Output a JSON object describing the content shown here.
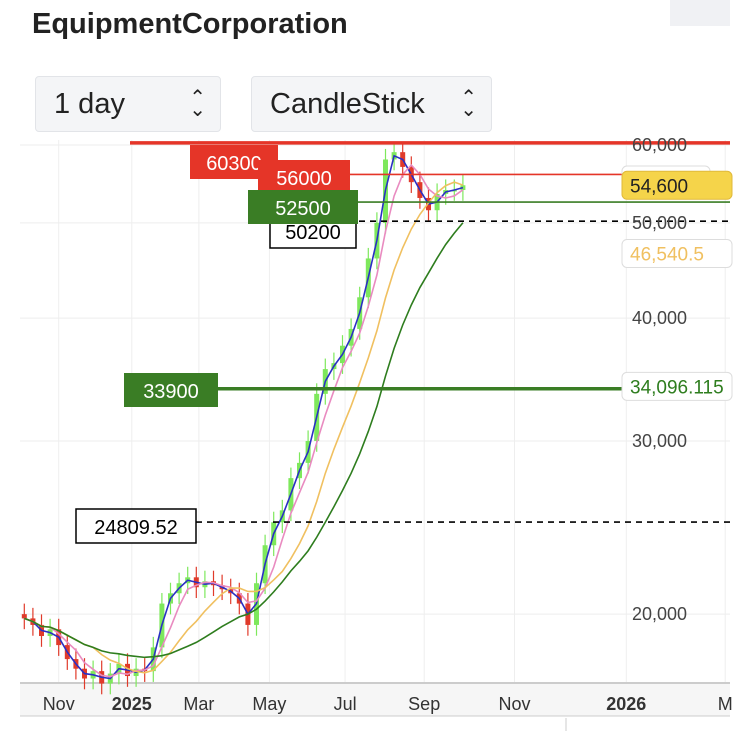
{
  "title": "EquipmentCorporation",
  "controls": {
    "interval": "1 day",
    "chart_type": "CandleStick"
  },
  "chart_data": {
    "type": "candlestick",
    "scale": "log",
    "ylim": [
      16500,
      62000
    ],
    "y_ticks": [
      {
        "v": 60000,
        "label": "60,000"
      },
      {
        "v": 50000,
        "label": "50,000"
      },
      {
        "v": 40000,
        "label": "40,000"
      },
      {
        "v": 30000,
        "label": "30,000"
      },
      {
        "v": 20000,
        "label": "20,000"
      }
    ],
    "x_ticks": [
      {
        "w": 4.5,
        "label": "Nov",
        "bold": false
      },
      {
        "w": 13,
        "label": "2025",
        "bold": true
      },
      {
        "w": 20.8,
        "label": "Mar",
        "bold": false
      },
      {
        "w": 29,
        "label": "May",
        "bold": false
      },
      {
        "w": 37.8,
        "label": "Jul",
        "bold": false
      },
      {
        "w": 47,
        "label": "Sep",
        "bold": false
      },
      {
        "w": 57.5,
        "label": "Nov",
        "bold": false
      },
      {
        "w": 70.5,
        "label": "2026",
        "bold": true
      },
      {
        "w": 82,
        "label": "M",
        "bold": false
      }
    ],
    "weekly_closes": [
      19800,
      19500,
      19000,
      19300,
      18600,
      18000,
      17600,
      17200,
      17500,
      17000,
      17400,
      17800,
      17300,
      17600,
      17500,
      18500,
      20500,
      21000,
      21500,
      21800,
      21300,
      21600,
      21400,
      21200,
      21000,
      20500,
      19500,
      21500,
      23500,
      24800,
      25500,
      27500,
      28500,
      30000,
      33500,
      35500,
      36000,
      37500,
      39000,
      42000,
      46000,
      50000,
      58000,
      59000,
      57000,
      55000,
      53000,
      51500,
      53500,
      54000,
      54000,
      54600
    ],
    "up_color": "#7ee85c",
    "down_color": "#e03a2a",
    "moving_averages": [
      {
        "color": "#2a2fc4",
        "window": 2
      },
      {
        "color": "#e98bc0",
        "window": 4
      },
      {
        "color": "#f0c060",
        "window": 9,
        "last_label": "46,540.5"
      },
      {
        "color": "#2e7d1e",
        "window": 16,
        "last_label": "34,096.115"
      }
    ],
    "levels": [
      {
        "value": 60300,
        "label": "60300",
        "color": "#e53528",
        "style": "solid-thick",
        "label_pos": "left"
      },
      {
        "value": 56000,
        "label": "56000",
        "color": "#e53528",
        "style": "solid",
        "label_pos": "mid"
      },
      {
        "value": 52500,
        "label": "52500",
        "color": "#3a7d25",
        "style": "solid",
        "label_pos": "mid2"
      },
      {
        "value": 50200,
        "label": "50200",
        "color": "#000000",
        "style": "dashed",
        "label_pos": "mid3"
      },
      {
        "value": 33900,
        "label": "33900",
        "color": "#3a7d25",
        "style": "solid-thick",
        "label_pos": "left2"
      },
      {
        "value": 24809.52,
        "label": "24809.52",
        "color": "#000000",
        "style": "dashed",
        "label_pos": "left3"
      }
    ],
    "last_price": {
      "value": 54600,
      "label": "54,600",
      "color": "#f5d44a"
    }
  }
}
